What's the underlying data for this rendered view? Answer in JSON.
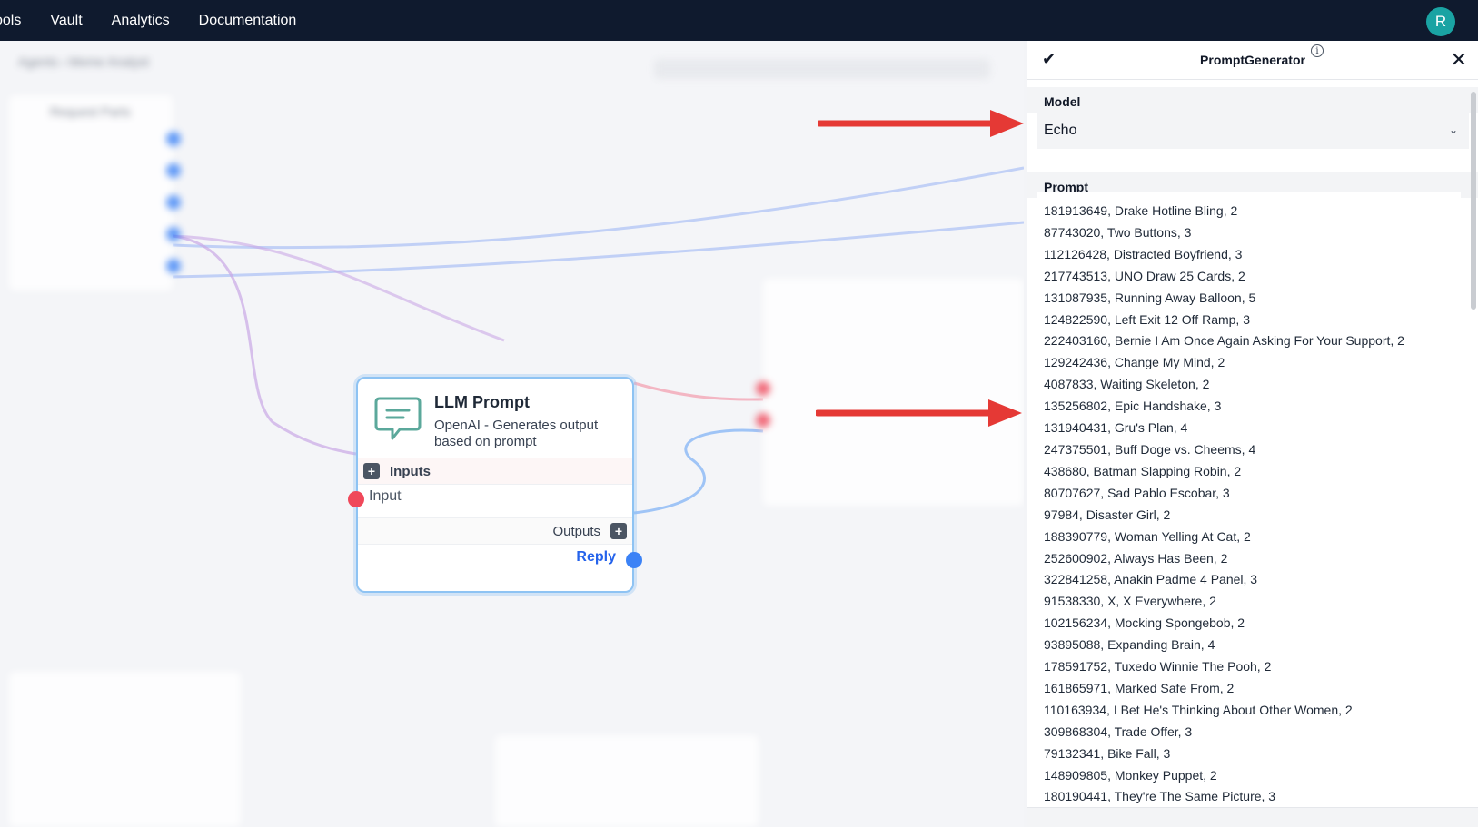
{
  "nav": {
    "items": [
      "ools",
      "Vault",
      "Analytics",
      "Documentation"
    ],
    "avatar_initial": "R"
  },
  "node": {
    "title": "LLM Prompt",
    "description": "OpenAI - Generates output based on prompt",
    "inputs_label": "Inputs",
    "input_port_label": "Input",
    "outputs_label": "Outputs",
    "output_port_label": "Reply",
    "plus": "+"
  },
  "panel": {
    "title": "PromptGenerator",
    "info_glyph": "i",
    "check_glyph": "✔",
    "close_glyph": "✕",
    "model_label": "Model",
    "model_value": "Echo",
    "chevron_glyph": "⌄",
    "prompt_label": "Prompt",
    "prompt_lines": [
      "181913649, Drake Hotline Bling, 2",
      "87743020, Two Buttons, 3",
      "112126428, Distracted Boyfriend, 3",
      "217743513, UNO Draw 25 Cards, 2",
      "131087935, Running Away Balloon, 5",
      "124822590, Left Exit 12 Off Ramp, 3",
      "222403160, Bernie I Am Once Again Asking For Your Support, 2",
      "129242436, Change My Mind, 2",
      "4087833, Waiting Skeleton, 2",
      "135256802, Epic Handshake, 3",
      "131940431, Gru's Plan, 4",
      "247375501, Buff Doge vs. Cheems, 4",
      "438680, Batman Slapping Robin, 2",
      "80707627, Sad Pablo Escobar, 3",
      "97984, Disaster Girl, 2",
      "188390779, Woman Yelling At Cat, 2",
      "252600902, Always Has Been, 2",
      "322841258, Anakin Padme 4 Panel, 3",
      "91538330, X, X Everywhere, 2",
      "102156234, Mocking Spongebob, 2",
      "93895088, Expanding Brain, 4",
      "178591752, Tuxedo Winnie The Pooh, 2",
      "161865971, Marked Safe From, 2",
      "110163934, I Bet He's Thinking About Other Women, 2",
      "309868304, Trade Offer, 3",
      "79132341, Bike Fall, 3",
      "148909805, Monkey Puppet, 2",
      "180190441, They're The Same Picture, 3"
    ]
  },
  "colors": {
    "nav_bg": "#0f1a2e",
    "avatar_bg": "#1aa3a3",
    "accent_blue": "#3b82f6",
    "port_red": "#f0485a",
    "arrow_red": "#e53935",
    "node_icon": "#5ba89b"
  }
}
